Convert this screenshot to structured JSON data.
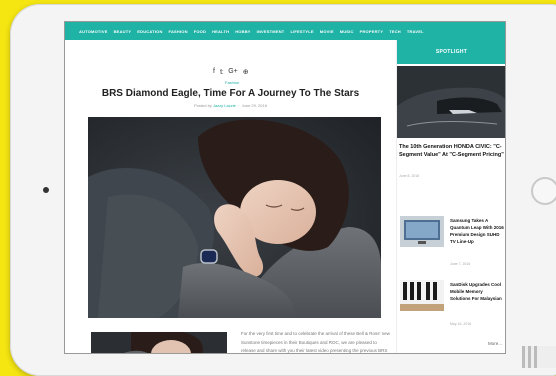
{
  "nav": [
    "AUTOMOTIVE",
    "BEAUTY",
    "EDUCATION",
    "FASHION",
    "FOOD",
    "HEALTH",
    "HOBBY",
    "INVESTMENT",
    "LIFESTYLE",
    "MOVIE",
    "MUSIC",
    "PROPERTY",
    "TECH",
    "TRAVEL"
  ],
  "article": {
    "social_icons": [
      "f",
      "𝕥",
      "G+",
      "⊕"
    ],
    "category": "Fashion",
    "title": "BRS Diamond Eagle, Time For A Journey To The Stars",
    "posted_by": "Posted by",
    "author": "Jazzy Lazzie",
    "date": "June 29, 2016",
    "body": "For the very first time and to celebrate the arrival of these Bell & Ross' new Sunstone timepieces in their Boutiques and ROC, we are pleased to release and share with you their latest video presenting the previous BRS"
  },
  "sidebar": {
    "heading": "SPOTLIGHT",
    "featured_title": "The 10th Generation HONDA CIVIC: \"C-Segment Value\" At \"C-Segment Pricing\"",
    "featured_date": "June 8, 2016",
    "items": [
      {
        "title": "Samsung Takes A Quantum Leap With 2016 Premium Design SUHD TV Line-Up",
        "date": "June 7, 2016"
      },
      {
        "title": "SanDisk Upgrades Cool Mobile Memory Solutions For Malaysian",
        "date": "May 16, 2016"
      }
    ],
    "more": "More..."
  },
  "colors": {
    "accent": "#1fb3a6",
    "frame_bg": "#f5e612"
  }
}
